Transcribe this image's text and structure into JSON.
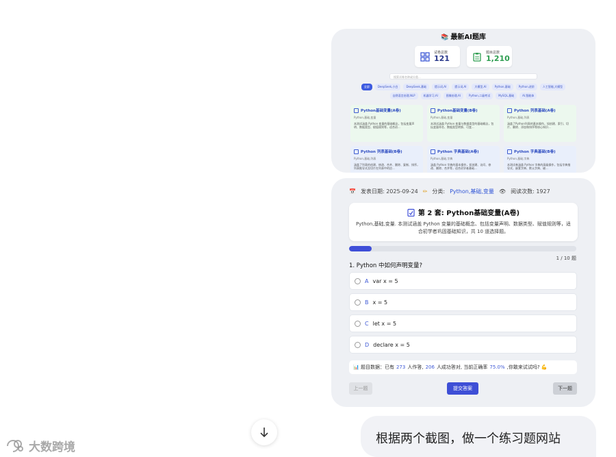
{
  "library": {
    "title": "最新AI题库",
    "stats": [
      {
        "label": "试卷总数",
        "value": "121"
      },
      {
        "label": "题目总数",
        "value": "1,210"
      }
    ],
    "search_placeholder": "搜索试卷名称或分类...",
    "tags": [
      "全部",
      "DeepSeek,小白",
      "DeepSeek,基础",
      "提示词,AI",
      "提示词,AI",
      "大模型,AI",
      "Python,基础",
      "Python,进阶",
      "人工智能,大模型",
      "自然语言处理,NLP",
      "机器学习,AI",
      "图像处理,AI",
      "Python,二级考试",
      "MySQL,基础",
      "AI,智能体"
    ],
    "cards": [
      {
        "title": "Python基础变量(A卷)",
        "sub": "Python,基础,变量",
        "desc": "本测试涵盖 Python 变量的基础概念，包括变量声明、数据类型、赋值规则等，适合初..."
      },
      {
        "title": "Python基础变量(B卷)",
        "sub": "Python,基础,变量",
        "desc": "本测试涵盖 Python 变量与数据类型的基础概念，包括变量命名、数据类型转换、可变..."
      },
      {
        "title": "Python 列表基础(A卷)",
        "sub": "Python,基础,列表",
        "desc": "涵盖了Python列表的基本操作，如创建、索引、切片、删除、添加和排序等核心知识..."
      },
      {
        "title": "Python 列表基础(B卷)",
        "sub": "Python,基础,列表",
        "desc": "涵盖了列表的创建、修改、合并、删除、复制、排序，列表推导式及切片在列表中的应..."
      },
      {
        "title": "Python 字典基础(A卷)",
        "sub": "Python,基础,字典",
        "desc": "涵盖 Python 字典的基本操作，如创建、访问、修改、删除、合并等，适合初学者基础..."
      },
      {
        "title": "Python 字典基础(B卷)",
        "sub": "Python,基础,字典",
        "desc": "本测试卷涵盖 Python 字典的高级操作，包括字典推导式、嵌套字典、默认字典、键..."
      }
    ]
  },
  "quiz": {
    "date_label": "发表日期: 2025-09-24",
    "category_prefix": "分类:",
    "category": "Python,基础,变量",
    "views_label": "阅读次数: 1927",
    "title": "第 2 套: Python基础变量(A卷)",
    "description": "Python,基础,变量. 本测试涵盖 Python 变量的基础概念、包括变量声明、数据类型、赋值规则等，适合初学者巩固基础知识，共 10 道选择题。",
    "progress": 0.1,
    "progress_label": "1 / 10 题",
    "question": "1. Python 中如何声明变量?",
    "options": [
      {
        "letter": "A",
        "text": "var x = 5"
      },
      {
        "letter": "B",
        "text": "x = 5"
      },
      {
        "letter": "C",
        "text": "let x = 5"
      },
      {
        "letter": "D",
        "text": "declare x = 5"
      }
    ],
    "stats": {
      "prefix": "📊 题目数据：已有",
      "answered": "273",
      "mid1": "人作答,",
      "correct": "206",
      "mid2": "人成功答对,  当前正确率",
      "rate": "75.0%",
      "suffix": ",你敢来试试吗? 💪"
    },
    "prev_label": "上一题",
    "submit_label": "提交答案",
    "next_label": "下一题"
  },
  "chat": {
    "message": "根据两个截图，做一个练习题网站"
  },
  "watermark": "大数跨境"
}
